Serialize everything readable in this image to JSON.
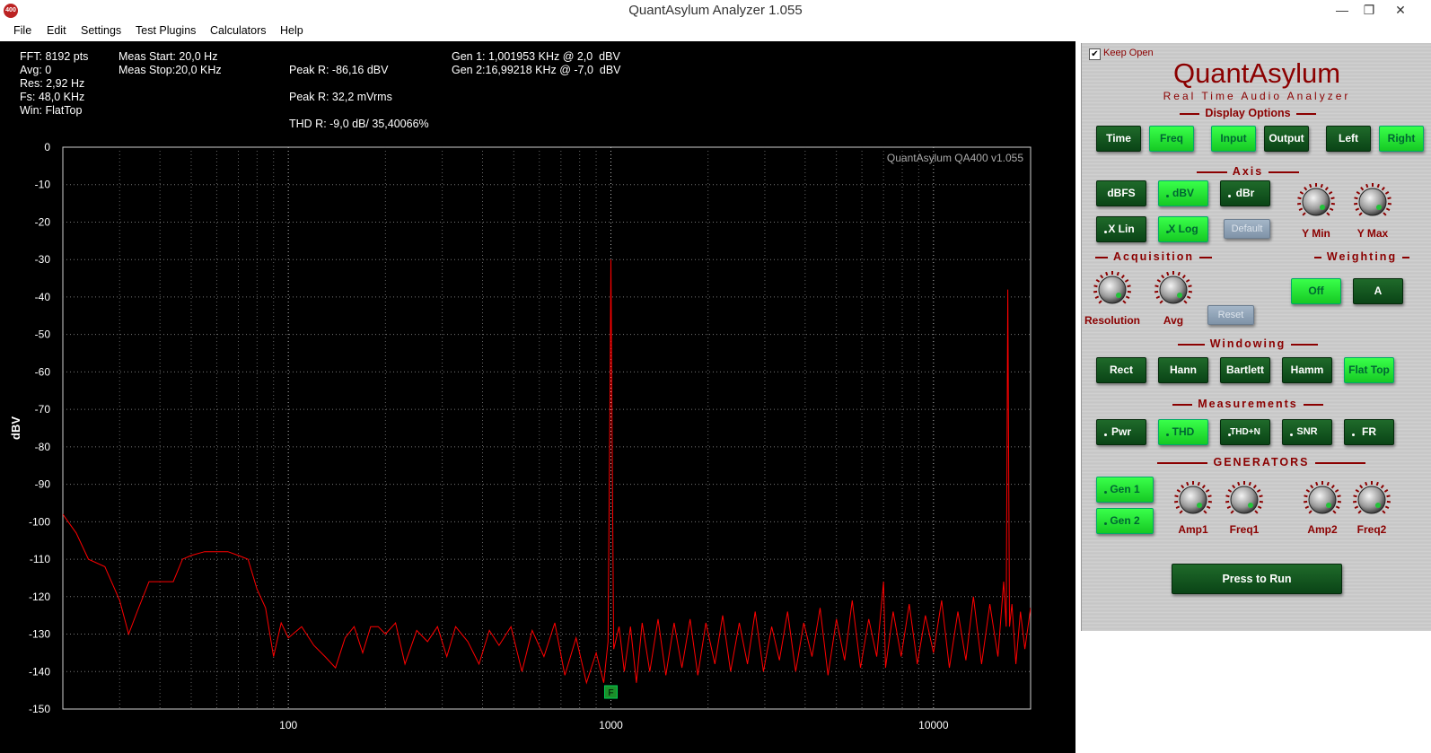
{
  "window": {
    "title": "QuantAsylum Analyzer 1.055",
    "icon_text": "400",
    "minimize": "—",
    "restore": "❐",
    "close": "✕"
  },
  "menu": [
    "File",
    "Edit",
    "Settings",
    "Test Plugins",
    "Calculators",
    "Help"
  ],
  "info": {
    "fft": "FFT: 8192 pts",
    "avg": "Avg: 0",
    "res": "Res: 2,92 Hz",
    "fs": "Fs: 48,0 KHz",
    "win": "Win: FlatTop",
    "meas_start": "Meas Start: 20,0 Hz",
    "meas_stop": "Meas Stop:20,0 KHz",
    "peak_r_dbv": "Peak R: -86,16 dBV",
    "peak_r_mvrms": "Peak R: 32,2 mVrms",
    "thd_r": "THD R: -9,0 dB/ 35,40066%",
    "gen1": "Gen 1: 1,001953 KHz @ 2,0  dBV",
    "gen2": "Gen 2:16,99218 KHz @ -7,0  dBV"
  },
  "chart_data": {
    "type": "line",
    "watermark": "QuantAsylum QA400 v1.055",
    "ylabel": "dBV",
    "xlabel": "",
    "x_scale": "log",
    "xlim": [
      20,
      20000
    ],
    "ylim": [
      -150,
      0
    ],
    "y_ticks": [
      0,
      -10,
      -20,
      -30,
      -40,
      -50,
      -60,
      -70,
      -80,
      -90,
      -100,
      -110,
      -120,
      -130,
      -140,
      -150
    ],
    "x_ticks": [
      100,
      1000,
      10000
    ],
    "grid": true,
    "marker_label": "F",
    "marker_freq": 1000,
    "line_color": "#ff0000",
    "series": [
      {
        "points": [
          [
            20,
            -98
          ],
          [
            22,
            -103
          ],
          [
            24,
            -110
          ],
          [
            27,
            -112
          ],
          [
            30,
            -121
          ],
          [
            32,
            -130
          ],
          [
            34,
            -124
          ],
          [
            37,
            -116
          ],
          [
            40,
            -116
          ],
          [
            44,
            -116
          ],
          [
            47,
            -110
          ],
          [
            50,
            -109
          ],
          [
            55,
            -108
          ],
          [
            60,
            -108
          ],
          [
            65,
            -108
          ],
          [
            70,
            -109
          ],
          [
            75,
            -110
          ],
          [
            80,
            -118
          ],
          [
            85,
            -123
          ],
          [
            90,
            -136
          ],
          [
            95,
            -127
          ],
          [
            100,
            -131
          ],
          [
            110,
            -128
          ],
          [
            120,
            -133
          ],
          [
            130,
            -136
          ],
          [
            140,
            -139
          ],
          [
            150,
            -131
          ],
          [
            160,
            -128
          ],
          [
            170,
            -135
          ],
          [
            180,
            -128
          ],
          [
            190,
            -128
          ],
          [
            200,
            -130
          ],
          [
            215,
            -127
          ],
          [
            230,
            -138
          ],
          [
            250,
            -129
          ],
          [
            270,
            -132
          ],
          [
            290,
            -128
          ],
          [
            310,
            -136
          ],
          [
            330,
            -128
          ],
          [
            360,
            -132
          ],
          [
            390,
            -138
          ],
          [
            420,
            -129
          ],
          [
            450,
            -133
          ],
          [
            490,
            -128
          ],
          [
            530,
            -140
          ],
          [
            570,
            -129
          ],
          [
            620,
            -136
          ],
          [
            670,
            -127
          ],
          [
            720,
            -141
          ],
          [
            780,
            -131
          ],
          [
            840,
            -143
          ],
          [
            900,
            -135
          ],
          [
            950,
            -143
          ],
          [
            980,
            -132
          ],
          [
            995,
            -60
          ],
          [
            1000,
            -30
          ],
          [
            1005,
            -60
          ],
          [
            1020,
            -134
          ],
          [
            1060,
            -128
          ],
          [
            1100,
            -140
          ],
          [
            1150,
            -128
          ],
          [
            1200,
            -143
          ],
          [
            1250,
            -127
          ],
          [
            1320,
            -140
          ],
          [
            1400,
            -126
          ],
          [
            1480,
            -141
          ],
          [
            1570,
            -127
          ],
          [
            1660,
            -139
          ],
          [
            1760,
            -126
          ],
          [
            1860,
            -141
          ],
          [
            1970,
            -127
          ],
          [
            2100,
            -138
          ],
          [
            2220,
            -125
          ],
          [
            2350,
            -140
          ],
          [
            2500,
            -127
          ],
          [
            2650,
            -138
          ],
          [
            2800,
            -124
          ],
          [
            2970,
            -140
          ],
          [
            3150,
            -128
          ],
          [
            3330,
            -137
          ],
          [
            3530,
            -124
          ],
          [
            3740,
            -140
          ],
          [
            3960,
            -127
          ],
          [
            4200,
            -136
          ],
          [
            4450,
            -123
          ],
          [
            4710,
            -141
          ],
          [
            5000,
            -126
          ],
          [
            5300,
            -137
          ],
          [
            5600,
            -121
          ],
          [
            5940,
            -139
          ],
          [
            6300,
            -126
          ],
          [
            6670,
            -136
          ],
          [
            7000,
            -116
          ],
          [
            7100,
            -139
          ],
          [
            7500,
            -124
          ],
          [
            7940,
            -136
          ],
          [
            8410,
            -122
          ],
          [
            8910,
            -138
          ],
          [
            9440,
            -125
          ],
          [
            10000,
            -135
          ],
          [
            10600,
            -121
          ],
          [
            11200,
            -139
          ],
          [
            11900,
            -124
          ],
          [
            12600,
            -137
          ],
          [
            13300,
            -120
          ],
          [
            14100,
            -138
          ],
          [
            14950,
            -122
          ],
          [
            15840,
            -136
          ],
          [
            16500,
            -116
          ],
          [
            16800,
            -128
          ],
          [
            17000,
            -38
          ],
          [
            17200,
            -128
          ],
          [
            17500,
            -122
          ],
          [
            18000,
            -138
          ],
          [
            18600,
            -124
          ],
          [
            19200,
            -134
          ],
          [
            20000,
            -123
          ]
        ]
      }
    ]
  },
  "panel": {
    "keep_open": "Keep Open",
    "keep_open_checked": "✔",
    "brand": "QuantAsylum",
    "tagline": "Real Time Audio Analyzer",
    "display_options": {
      "title": "Display Options",
      "buttons": [
        {
          "label": "Time",
          "on": false
        },
        {
          "label": "Freq",
          "on": true
        },
        {
          "label": "Input",
          "on": true
        },
        {
          "label": "Output",
          "on": false
        },
        {
          "label": "Left",
          "on": false
        },
        {
          "label": "Right",
          "on": true
        }
      ]
    },
    "axis": {
      "title": "Axis",
      "buttons": [
        {
          "label": "dBFS",
          "on": false
        },
        {
          "label": "dBV",
          "on": true
        },
        {
          "label": "dBr",
          "on": false
        },
        {
          "label": "X Lin",
          "on": false
        },
        {
          "label": "X Log",
          "on": true
        },
        {
          "label": "Default",
          "disabled": true
        }
      ],
      "knobs": [
        "Y Min",
        "Y Max"
      ]
    },
    "acquisition": {
      "title": "Acquisition",
      "knobs": [
        "Resolution",
        "Avg"
      ],
      "reset": "Reset"
    },
    "weighting": {
      "title": "Weighting",
      "buttons": [
        {
          "label": "Off",
          "on": true
        },
        {
          "label": "A",
          "on": false
        }
      ]
    },
    "windowing": {
      "title": "Windowing",
      "buttons": [
        {
          "label": "Rect",
          "on": false
        },
        {
          "label": "Hann",
          "on": false
        },
        {
          "label": "Bartlett",
          "on": false
        },
        {
          "label": "Hamm",
          "on": false
        },
        {
          "label": "Flat Top",
          "on": true
        }
      ]
    },
    "measurements": {
      "title": "Measurements",
      "buttons": [
        {
          "label": "Pwr",
          "on": false
        },
        {
          "label": "THD",
          "on": true
        },
        {
          "label": "THD+N",
          "on": false
        },
        {
          "label": "SNR",
          "on": false
        },
        {
          "label": "FR",
          "on": false
        }
      ]
    },
    "generators": {
      "title": "GENERATORS",
      "buttons": [
        {
          "label": "Gen 1",
          "on": true
        },
        {
          "label": "Gen 2",
          "on": true
        }
      ],
      "knobs": [
        "Amp1",
        "Freq1",
        "Amp2",
        "Freq2"
      ]
    },
    "run": "Press to Run"
  }
}
